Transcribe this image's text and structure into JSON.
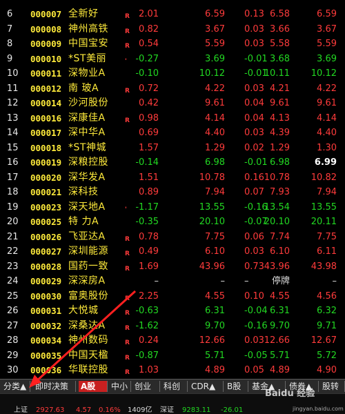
{
  "rows": [
    {
      "idx": "6",
      "code": "000007",
      "name": "全新好",
      "flag": "R",
      "chg": "2.01",
      "price": "6.59",
      "diff": "0.13",
      "prev": "6.58",
      "open": "6.59",
      "dir": "up"
    },
    {
      "idx": "7",
      "code": "000008",
      "name": "神州高铁",
      "flag": "R",
      "chg": "0.82",
      "price": "3.67",
      "diff": "0.03",
      "prev": "3.66",
      "open": "3.67",
      "dir": "up"
    },
    {
      "idx": "8",
      "code": "000009",
      "name": "中国宝安",
      "flag": "R",
      "chg": "0.54",
      "price": "5.59",
      "diff": "0.03",
      "prev": "5.58",
      "open": "5.59",
      "dir": "up"
    },
    {
      "idx": "9",
      "code": "000010",
      "name": "*ST美丽",
      "flag": "'",
      "chg": "-0.27",
      "price": "3.69",
      "diff": "-0.01",
      "prev": "3.68",
      "open": "3.69",
      "dir": "down"
    },
    {
      "idx": "10",
      "code": "000011",
      "name": "深物业A",
      "flag": "",
      "chg": "-0.10",
      "price": "10.12",
      "diff": "-0.01",
      "prev": "10.11",
      "open": "10.12",
      "dir": "down"
    },
    {
      "idx": "11",
      "code": "000012",
      "name": "南 玻A",
      "flag": "R",
      "chg": "0.72",
      "price": "4.22",
      "diff": "0.03",
      "prev": "4.21",
      "open": "4.22",
      "dir": "up"
    },
    {
      "idx": "12",
      "code": "000014",
      "name": "沙河股份",
      "flag": "",
      "chg": "0.42",
      "price": "9.61",
      "diff": "0.04",
      "prev": "9.61",
      "open": "9.61",
      "dir": "up"
    },
    {
      "idx": "13",
      "code": "000016",
      "name": "深康佳A",
      "flag": "R",
      "chg": "0.98",
      "price": "4.14",
      "diff": "0.04",
      "prev": "4.13",
      "open": "4.14",
      "dir": "up"
    },
    {
      "idx": "14",
      "code": "000017",
      "name": "深中华A",
      "flag": "",
      "chg": "0.69",
      "price": "4.40",
      "diff": "0.03",
      "prev": "4.39",
      "open": "4.40",
      "dir": "up"
    },
    {
      "idx": "15",
      "code": "000018",
      "name": "*ST神城",
      "flag": "",
      "chg": "1.57",
      "price": "1.29",
      "diff": "0.02",
      "prev": "1.29",
      "open": "1.30",
      "dir": "up"
    },
    {
      "idx": "16",
      "code": "000019",
      "name": "深粮控股",
      "flag": "",
      "chg": "-0.14",
      "price": "6.98",
      "diff": "-0.01",
      "prev": "6.98",
      "open": "6.99",
      "dir": "down",
      "openHL": true
    },
    {
      "idx": "17",
      "code": "000020",
      "name": "深华发A",
      "flag": "",
      "chg": "1.51",
      "price": "10.78",
      "diff": "0.16",
      "prev": "10.78",
      "open": "10.82",
      "dir": "up"
    },
    {
      "idx": "18",
      "code": "000021",
      "name": "深科技",
      "flag": "",
      "chg": "0.89",
      "price": "7.94",
      "diff": "0.07",
      "prev": "7.93",
      "open": "7.94",
      "dir": "up"
    },
    {
      "idx": "19",
      "code": "000023",
      "name": "深天地A",
      "flag": "'",
      "chg": "-1.17",
      "price": "13.55",
      "diff": "-0.16",
      "prev": "13.54",
      "open": "13.55",
      "dir": "down"
    },
    {
      "idx": "20",
      "code": "000025",
      "name": "特 力A",
      "flag": "",
      "chg": "-0.35",
      "price": "20.10",
      "diff": "-0.07",
      "prev": "20.10",
      "open": "20.11",
      "dir": "down"
    },
    {
      "idx": "21",
      "code": "000026",
      "name": "飞亚达A",
      "flag": "R",
      "chg": "0.78",
      "price": "7.75",
      "diff": "0.06",
      "prev": "7.74",
      "open": "7.75",
      "dir": "up"
    },
    {
      "idx": "22",
      "code": "000027",
      "name": "深圳能源",
      "flag": "R",
      "chg": "0.49",
      "price": "6.10",
      "diff": "0.03",
      "prev": "6.10",
      "open": "6.11",
      "dir": "up"
    },
    {
      "idx": "23",
      "code": "000028",
      "name": "国药一致",
      "flag": "R",
      "chg": "1.69",
      "price": "43.96",
      "diff": "0.73",
      "prev": "43.96",
      "open": "43.98",
      "dir": "up"
    },
    {
      "idx": "24",
      "code": "000029",
      "name": "深深房A",
      "flag": "",
      "chg": "–",
      "price": "–",
      "diff": "–",
      "prev": "停牌",
      "open": "–",
      "dir": "flat"
    },
    {
      "idx": "25",
      "code": "000030",
      "name": "富奥股份",
      "flag": "R",
      "chg": "2.25",
      "price": "4.55",
      "diff": "0.10",
      "prev": "4.55",
      "open": "4.56",
      "dir": "up"
    },
    {
      "idx": "26",
      "code": "000031",
      "name": "大悦城",
      "flag": "R",
      "chg": "-0.63",
      "price": "6.31",
      "diff": "-0.04",
      "prev": "6.31",
      "open": "6.32",
      "dir": "down"
    },
    {
      "idx": "27",
      "code": "000032",
      "name": "深桑达A",
      "flag": "R",
      "chg": "-1.62",
      "price": "9.70",
      "diff": "-0.16",
      "prev": "9.70",
      "open": "9.71",
      "dir": "down"
    },
    {
      "idx": "28",
      "code": "000034",
      "name": "神州数码",
      "flag": "R",
      "chg": "0.24",
      "price": "12.66",
      "diff": "0.03",
      "prev": "12.66",
      "open": "12.67",
      "dir": "up"
    },
    {
      "idx": "29",
      "code": "000035",
      "name": "中国天楹",
      "flag": "R",
      "chg": "-0.87",
      "price": "5.71",
      "diff": "-0.05",
      "prev": "5.71",
      "open": "5.72",
      "dir": "down"
    },
    {
      "idx": "30",
      "code": "000036",
      "name": "华联控股",
      "flag": "R",
      "chg": "1.03",
      "price": "4.89",
      "diff": "0.05",
      "prev": "4.89",
      "open": "4.90",
      "dir": "up"
    }
  ],
  "tabs": [
    {
      "label": "分类▲",
      "name": "tab-category"
    },
    {
      "label": "即时决策",
      "name": "tab-realtime-decision"
    },
    {
      "label": "A股",
      "name": "tab-a-shares",
      "active": true
    },
    {
      "label": "中小",
      "name": "tab-sme"
    },
    {
      "label": "创业",
      "name": "tab-chinext"
    },
    {
      "label": "科创",
      "name": "tab-star"
    },
    {
      "label": "CDR▲",
      "name": "tab-cdr"
    },
    {
      "label": "B股",
      "name": "tab-b-shares"
    },
    {
      "label": "基金▲",
      "name": "tab-fund"
    },
    {
      "label": "债券▲",
      "name": "tab-bond"
    },
    {
      "label": "股转",
      "name": "tab-neeq"
    }
  ],
  "status": {
    "sh_label": "上证",
    "sh_value": "2927.63",
    "sh_change": "4.57",
    "sh_pct": "0.16%",
    "sh_amount": "1409亿",
    "sz_label": "深证",
    "sz_value": "9283.11",
    "sz_change": "-26.01"
  },
  "watermark": {
    "brand": "Baidu 经验",
    "url": "jingyan.baidu.com"
  },
  "colors": {
    "up": "#ff3b3b",
    "down": "#22d822",
    "code": "#ffeb3b",
    "active_tab": "#c82020"
  }
}
